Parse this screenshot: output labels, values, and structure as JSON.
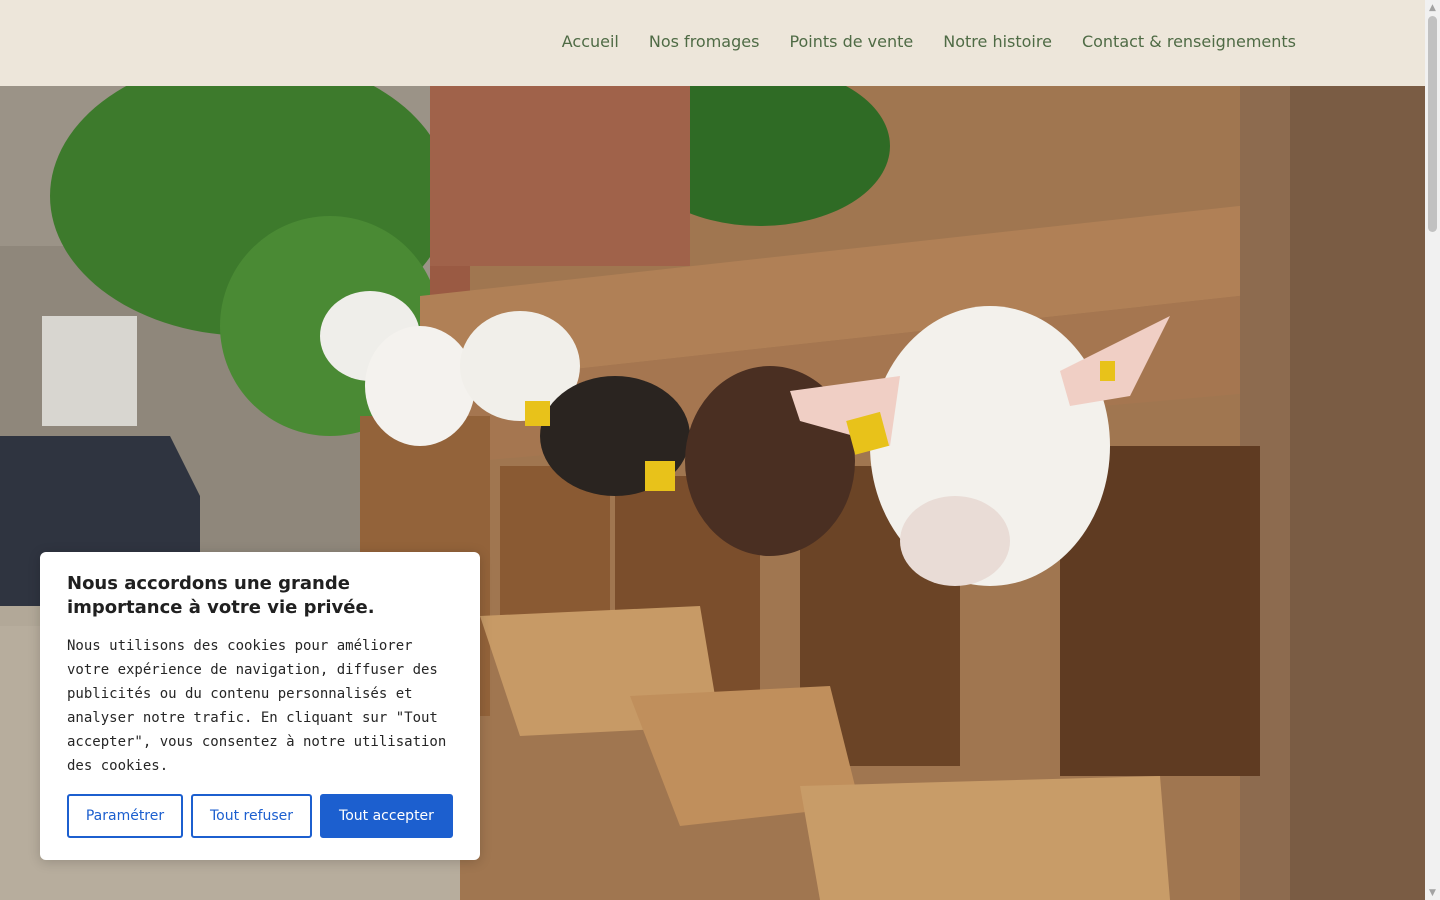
{
  "nav": {
    "items": [
      "Accueil",
      "Nos fromages",
      "Points de vente",
      "Notre histoire",
      "Contact & renseignements"
    ]
  },
  "hero": {
    "image_alt": "goats"
  },
  "cookie": {
    "title": "Nous accordons une grande importance à votre vie privée.",
    "body": "Nous utilisons des cookies pour améliorer votre expérience de navigation, diffuser des publicités ou du contenu personnalisés et analyser notre trafic. En cliquant sur \"Tout accepter\", vous consentez à notre utilisation des cookies.",
    "settings_label": "Paramétrer",
    "reject_label": "Tout refuser",
    "accept_label": "Tout accepter"
  },
  "colors": {
    "header_bg": "#ede6da",
    "nav_text": "#4f6b45",
    "accent": "#1c5fcf"
  }
}
